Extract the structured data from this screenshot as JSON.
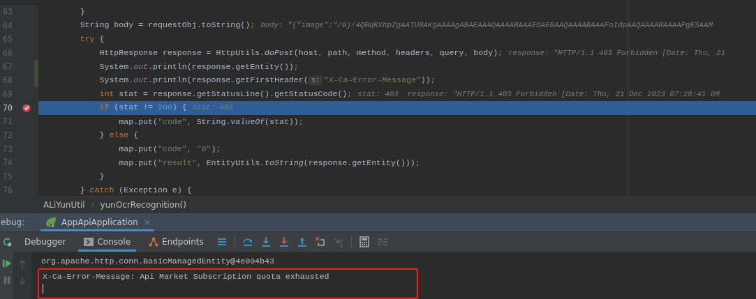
{
  "editor": {
    "lines": [
      {
        "number": "63",
        "modified": false,
        "current": false,
        "breakpoint": false,
        "tokens": [
          {
            "text": "        }",
            "kind": "plain"
          }
        ]
      },
      {
        "number": "64",
        "modified": false,
        "current": false,
        "breakpoint": false,
        "tokens": [
          {
            "text": "        String body = requestObj.toString()",
            "kind": "plain"
          },
          {
            "text": ";",
            "kind": "kw"
          },
          {
            "text": "body: \"{\"image\":\"/9j/4QBqRXhpZgAATU0AKgAAAAgABAEAAAQAAAABAAAEOAEBAAQAAAABAAAFoIdpAAQAAAABAAAAPgESAAM",
            "kind": "hint"
          }
        ]
      },
      {
        "number": "65",
        "modified": false,
        "current": false,
        "breakpoint": false,
        "tokens": [
          {
            "text": "        try",
            "kind": "kw"
          },
          {
            "text": " {",
            "kind": "plain"
          }
        ]
      },
      {
        "number": "66",
        "modified": false,
        "current": false,
        "breakpoint": false,
        "tokens": [
          {
            "text": "            HttpResponse response = HttpUtils.",
            "kind": "plain"
          },
          {
            "text": "doPost",
            "kind": "italic"
          },
          {
            "text": "(host",
            "kind": "plain"
          },
          {
            "text": ", ",
            "kind": "kw"
          },
          {
            "text": "path",
            "kind": "plain"
          },
          {
            "text": ", ",
            "kind": "kw"
          },
          {
            "text": "method",
            "kind": "plain"
          },
          {
            "text": ", ",
            "kind": "kw"
          },
          {
            "text": "headers",
            "kind": "plain"
          },
          {
            "text": ", ",
            "kind": "kw"
          },
          {
            "text": "query",
            "kind": "plain"
          },
          {
            "text": ", ",
            "kind": "kw"
          },
          {
            "text": "body)",
            "kind": "plain"
          },
          {
            "text": ";",
            "kind": "kw"
          },
          {
            "text": "response: \"HTTP/1.1 403 Forbidden [Date: Thu, 21",
            "kind": "hint"
          }
        ]
      },
      {
        "number": "67",
        "modified": true,
        "current": false,
        "breakpoint": false,
        "tokens": [
          {
            "text": "            System.",
            "kind": "plain"
          },
          {
            "text": "out",
            "kind": "field"
          },
          {
            "text": ".println(response.getEntity())",
            "kind": "plain"
          },
          {
            "text": ";",
            "kind": "kw"
          }
        ]
      },
      {
        "number": "68",
        "modified": true,
        "current": false,
        "breakpoint": false,
        "tokens": [
          {
            "text": "            System.",
            "kind": "plain"
          },
          {
            "text": "out",
            "kind": "field"
          },
          {
            "text": ".println(response.getFirstHeader(",
            "kind": "plain"
          },
          {
            "text": "s:",
            "kind": "chip"
          },
          {
            "text": "\"X-Ca-Error-Message\"",
            "kind": "str"
          },
          {
            "text": "))",
            "kind": "plain"
          },
          {
            "text": ";",
            "kind": "kw"
          }
        ]
      },
      {
        "number": "69",
        "modified": false,
        "current": false,
        "breakpoint": false,
        "tokens": [
          {
            "text": "            int",
            "kind": "kw"
          },
          {
            "text": " stat = response.getStatusLine().getStatusCode()",
            "kind": "plain"
          },
          {
            "text": ";",
            "kind": "kw"
          },
          {
            "text": "stat: 403  response: \"HTTP/1.1 403 Forbidden [Date: Thu, 21 Dec 2023 07:28:41 GM",
            "kind": "hint"
          }
        ]
      },
      {
        "number": "70",
        "modified": false,
        "current": true,
        "breakpoint": true,
        "tokens": [
          {
            "text": "            if",
            "kind": "kw"
          },
          {
            "text": " (stat != ",
            "kind": "plain"
          },
          {
            "text": "200",
            "kind": "num"
          },
          {
            "text": ") {",
            "kind": "plain"
          },
          {
            "text": "stat: 403",
            "kind": "hint"
          }
        ]
      },
      {
        "number": "71",
        "modified": false,
        "current": false,
        "breakpoint": false,
        "tokens": [
          {
            "text": "                map.put(",
            "kind": "plain"
          },
          {
            "text": "\"code\"",
            "kind": "str"
          },
          {
            "text": ", ",
            "kind": "kw"
          },
          {
            "text": "String.",
            "kind": "plain"
          },
          {
            "text": "valueOf",
            "kind": "italic"
          },
          {
            "text": "(stat))",
            "kind": "plain"
          },
          {
            "text": ";",
            "kind": "kw"
          }
        ]
      },
      {
        "number": "72",
        "modified": false,
        "current": false,
        "breakpoint": false,
        "tokens": [
          {
            "text": "            } ",
            "kind": "plain"
          },
          {
            "text": "else",
            "kind": "kw"
          },
          {
            "text": " {",
            "kind": "plain"
          }
        ]
      },
      {
        "number": "73",
        "modified": false,
        "current": false,
        "breakpoint": false,
        "tokens": [
          {
            "text": "                map.put(",
            "kind": "plain"
          },
          {
            "text": "\"code\"",
            "kind": "str"
          },
          {
            "text": ", ",
            "kind": "kw"
          },
          {
            "text": "\"0\"",
            "kind": "str"
          },
          {
            "text": ")",
            "kind": "plain"
          },
          {
            "text": ";",
            "kind": "kw"
          }
        ]
      },
      {
        "number": "74",
        "modified": false,
        "current": false,
        "breakpoint": false,
        "tokens": [
          {
            "text": "                map.put(",
            "kind": "plain"
          },
          {
            "text": "\"result\"",
            "kind": "str"
          },
          {
            "text": ", ",
            "kind": "kw"
          },
          {
            "text": "EntityUtils.",
            "kind": "plain"
          },
          {
            "text": "toString",
            "kind": "italic"
          },
          {
            "text": "(response.getEntity()))",
            "kind": "plain"
          },
          {
            "text": ";",
            "kind": "kw"
          }
        ]
      },
      {
        "number": "75",
        "modified": false,
        "current": false,
        "breakpoint": false,
        "tokens": [
          {
            "text": "            }",
            "kind": "plain"
          }
        ]
      },
      {
        "number": "76",
        "modified": false,
        "current": false,
        "breakpoint": false,
        "tokens": [
          {
            "text": "        } ",
            "kind": "plain"
          },
          {
            "text": "catch",
            "kind": "kw"
          },
          {
            "text": " (Exception e) {",
            "kind": "plain"
          }
        ]
      }
    ]
  },
  "breadcrumbs": [
    "ALiYunUtil",
    "yunOcrRecognition()"
  ],
  "debug": {
    "label": "ebug:",
    "sessions": [
      {
        "label": "AppApiApplication",
        "selected": true
      }
    ]
  },
  "tool_tabs": [
    {
      "label": "Debugger",
      "kind": "plain",
      "selected": false
    },
    {
      "label": "Console",
      "kind": "console",
      "selected": true
    },
    {
      "label": "Endpoints",
      "kind": "endpoints",
      "selected": false
    }
  ],
  "console": {
    "lines": [
      {
        "text": "org.apache.http.conn.BasicManagedEntity@4e004b43",
        "highlighted": false
      },
      {
        "text": "X-Ca-Error-Message: Api Market Subscription quota exhausted",
        "highlighted": true
      }
    ]
  }
}
